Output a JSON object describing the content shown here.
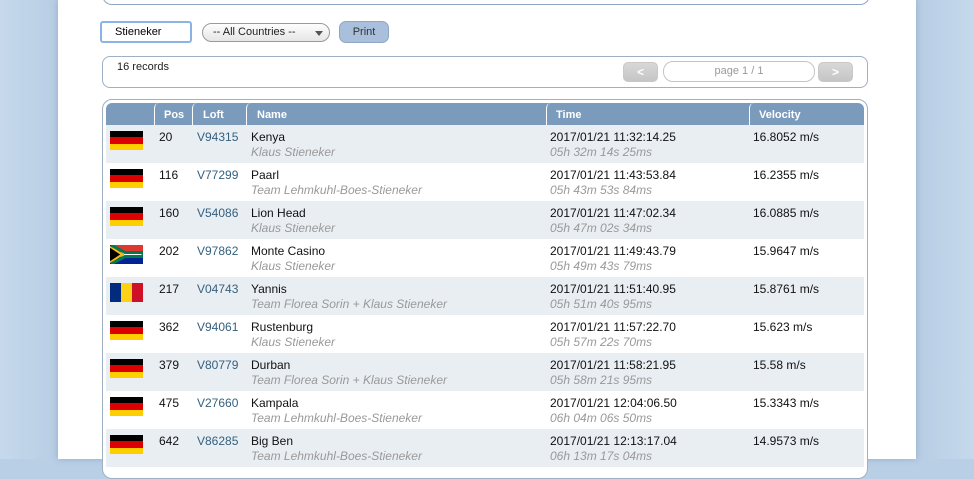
{
  "search": {
    "value": "Stieneker"
  },
  "country_filter": {
    "selected": "-- All Countries --"
  },
  "print_label": "Print",
  "records_text": "16 records",
  "pager": {
    "prev": "<",
    "next": ">",
    "indicator": "page 1 / 1"
  },
  "columns": {
    "pos": "Pos",
    "loft": "Loft",
    "name": "Name",
    "time": "Time",
    "velocity": "Velocity"
  },
  "colors": {
    "header": "#7b9bbd",
    "row_alt": "#e9eef3",
    "loft_text": "#34607f"
  },
  "rows": [
    {
      "flag": "de",
      "pos": "20",
      "loft": "V94315",
      "name": "Kenya",
      "owner": "Klaus Stieneker",
      "time": "2017/01/21 11:32:14.25",
      "duration": "05h 32m 14s 25ms",
      "velocity": "16.8052 m/s"
    },
    {
      "flag": "de",
      "pos": "116",
      "loft": "V77299",
      "name": "Paarl",
      "owner": "Team Lehmkuhl-Boes-Stieneker",
      "time": "2017/01/21 11:43:53.84",
      "duration": "05h 43m 53s 84ms",
      "velocity": "16.2355 m/s"
    },
    {
      "flag": "de",
      "pos": "160",
      "loft": "V54086",
      "name": "Lion Head",
      "owner": "Klaus Stieneker",
      "time": "2017/01/21 11:47:02.34",
      "duration": "05h 47m 02s 34ms",
      "velocity": "16.0885 m/s"
    },
    {
      "flag": "za",
      "pos": "202",
      "loft": "V97862",
      "name": "Monte Casino",
      "owner": "Klaus Stieneker",
      "time": "2017/01/21 11:49:43.79",
      "duration": "05h 49m 43s 79ms",
      "velocity": "15.9647 m/s"
    },
    {
      "flag": "ro",
      "pos": "217",
      "loft": "V04743",
      "name": "Yannis",
      "owner": "Team Florea Sorin + Klaus Stieneker",
      "time": "2017/01/21 11:51:40.95",
      "duration": "05h 51m 40s 95ms",
      "velocity": "15.8761 m/s"
    },
    {
      "flag": "de",
      "pos": "362",
      "loft": "V94061",
      "name": "Rustenburg",
      "owner": "Klaus Stieneker",
      "time": "2017/01/21 11:57:22.70",
      "duration": "05h 57m 22s 70ms",
      "velocity": "15.623 m/s"
    },
    {
      "flag": "de",
      "pos": "379",
      "loft": "V80779",
      "name": "Durban",
      "owner": "Team Florea Sorin + Klaus Stieneker",
      "time": "2017/01/21 11:58:21.95",
      "duration": "05h 58m 21s 95ms",
      "velocity": "15.58 m/s"
    },
    {
      "flag": "de",
      "pos": "475",
      "loft": "V27660",
      "name": "Kampala",
      "owner": "Team Lehmkuhl-Boes-Stieneker",
      "time": "2017/01/21 12:04:06.50",
      "duration": "06h 04m 06s 50ms",
      "velocity": "15.3343 m/s"
    },
    {
      "flag": "de",
      "pos": "642",
      "loft": "V86285",
      "name": "Big Ben",
      "owner": "Team Lehmkuhl-Boes-Stieneker",
      "time": "2017/01/21 12:13:17.04",
      "duration": "06h 13m 17s 04ms",
      "velocity": "14.9573 m/s"
    }
  ]
}
